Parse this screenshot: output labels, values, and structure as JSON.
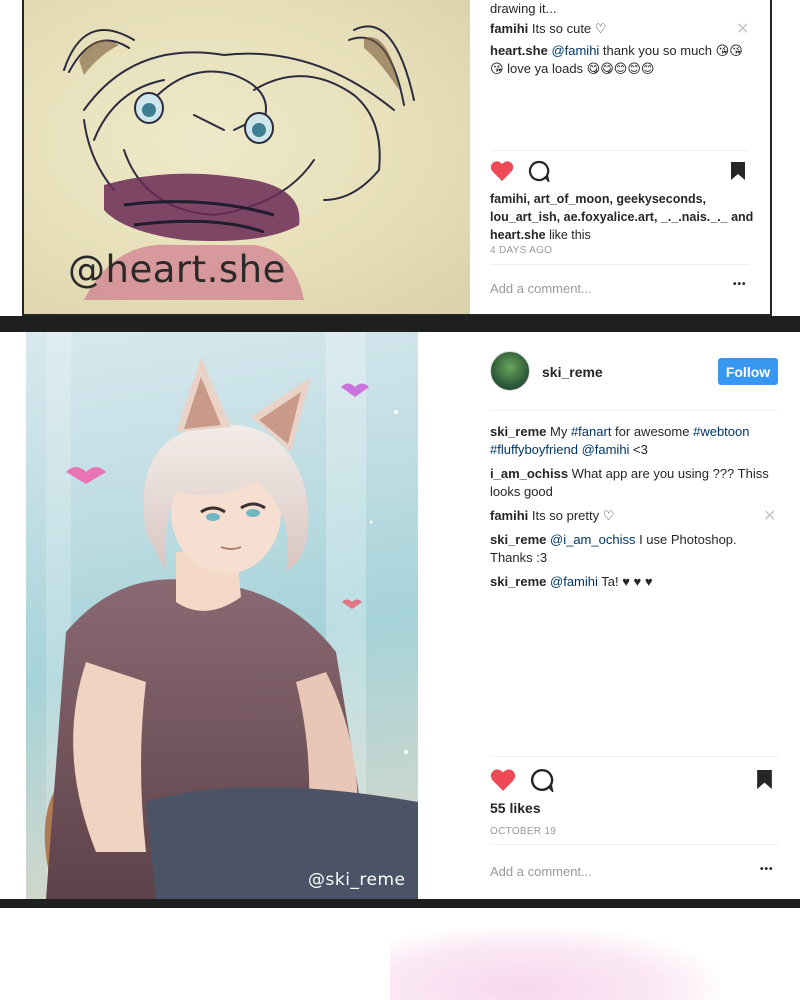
{
  "post1": {
    "watermark": "@heart.she",
    "comments": [
      {
        "text": "drawing it..."
      },
      {
        "user": "famihi",
        "text": " Its so cute ♡"
      },
      {
        "user": "heart.she",
        "mention": "@famihi",
        "text": " thank you so much 😘😘",
        "line2": "😘 love ya loads 😋😋😊😊😊"
      }
    ],
    "likes_line1": "famihi, art_of_moon, geekyseconds,",
    "likes_line2": "lou_art_ish, ae.foxyalice.art, _._.nais._._ and",
    "likes_line3_user": "heart.she",
    "likes_line3_text": " like this",
    "date": "4 DAYS AGO",
    "add_comment_placeholder": "Add a comment...",
    "more": "•••"
  },
  "post2": {
    "username": "ski_reme",
    "follow_label": "Follow",
    "watermark": "@ski_reme",
    "caption": {
      "user": "ski_reme",
      "text": " My ",
      "tag1": "#fanart",
      "text2": " for awesome ",
      "tag2": "#webtoon",
      "tag3": "#fluffyboyfriend",
      "mention": "@famihi",
      "text3": " <3"
    },
    "comments": [
      {
        "user": "i_am_ochiss",
        "text": " What app are you using ??? Thiss",
        "line2": "looks good"
      },
      {
        "user": "famihi",
        "text": " Its so pretty ♡"
      },
      {
        "user": "ski_reme",
        "mention": "@i_am_ochiss",
        "text": " I use Photoshop.",
        "line2": "Thanks :3"
      },
      {
        "user": "ski_reme",
        "mention": "@famihi",
        "text": " Ta! ♥ ♥ ♥"
      }
    ],
    "likes": "55 likes",
    "date": "OCTOBER 19",
    "add_comment_placeholder": "Add a comment...",
    "more": "•••"
  },
  "colors": {
    "heart": "#ed4956",
    "follow": "#3897f0",
    "link": "#003569",
    "strip": "#1f1f1f"
  },
  "icons": [
    "heart-icon",
    "comment-icon",
    "bookmark-icon",
    "close-icon",
    "more-icon"
  ]
}
